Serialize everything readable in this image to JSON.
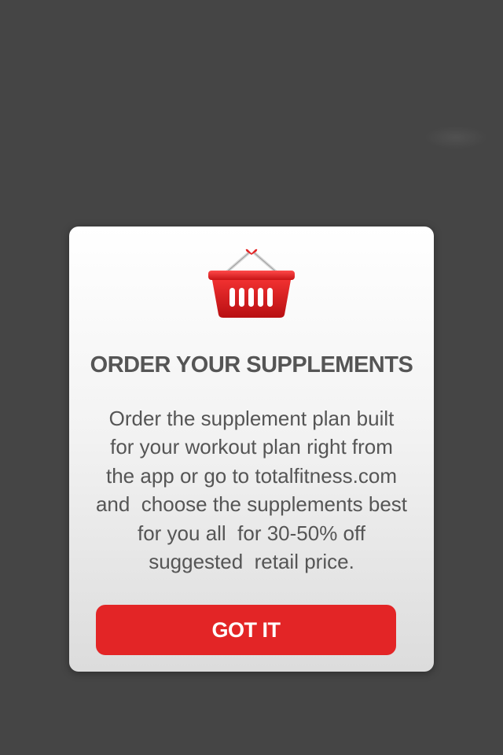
{
  "dialog": {
    "icon": "shopping-basket-icon",
    "title": "ORDER YOUR SUPPLEMENTS",
    "body_lines": [
      "Order the supplement plan built",
      "for your workout plan right from",
      "the app or go to totalfitness.com",
      "and  choose the supplements best",
      "for you all  for 30-50% off",
      "suggested  retail price."
    ],
    "button_label": "GOT IT"
  },
  "colors": {
    "background": "#454545",
    "button": "#e32526",
    "text": "#555555"
  }
}
